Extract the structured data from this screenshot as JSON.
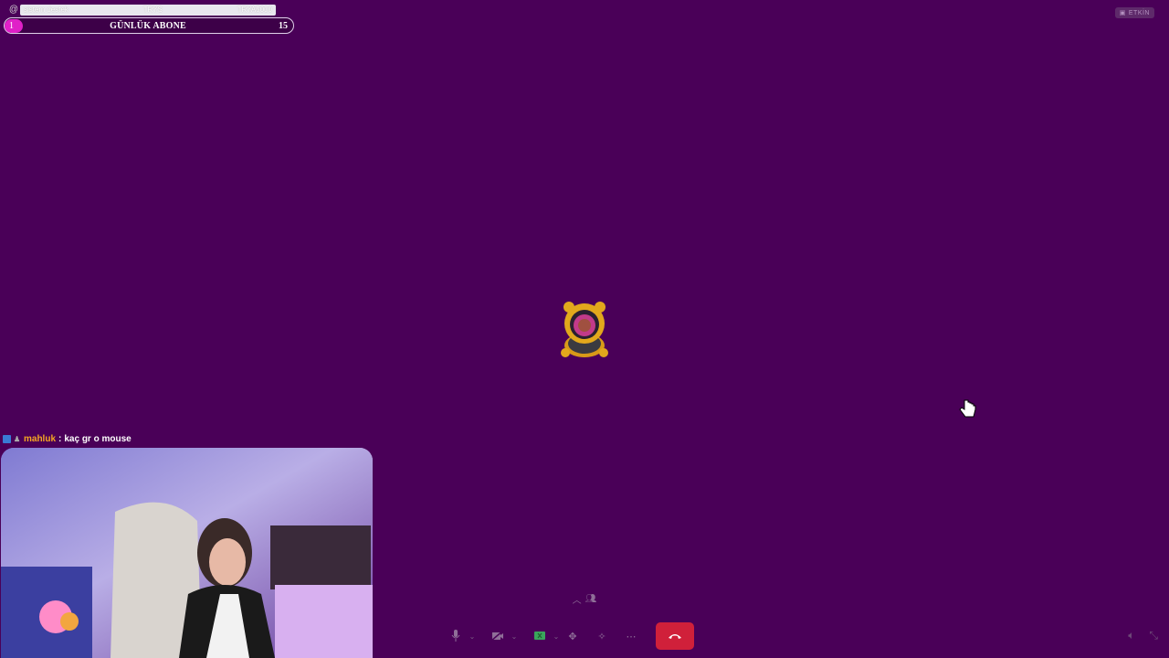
{
  "ticker": {
    "at_symbol": "@",
    "left_text": "sistem destek",
    "mid_text": "TRYS",
    "right_text": "TRYA5000"
  },
  "goal": {
    "current": "1",
    "title": "GÜNLÜK ABONE",
    "target": "15",
    "progress": 0.067,
    "fill_color": "#e020c8"
  },
  "top_right": {
    "label": "ETKİN",
    "icon": "screen-share-icon"
  },
  "call": {
    "background_color": "#4a0058",
    "participant_avatar_icon": "bear-avatar-icon"
  },
  "chat": {
    "username": "mahluk",
    "separator": " : ",
    "message": "kaç gr o mouse",
    "username_color": "#f5a623"
  },
  "controls": {
    "mic_icon": "microphone-icon",
    "camera_icon": "camera-off-icon",
    "screenshare_icon": "screen-share-icon",
    "activities_icon": "apps-icon",
    "soundboard_icon": "soundboard-icon",
    "more_icon": "more-icon",
    "hangup_icon": "phone-hangup-icon",
    "hangup_color": "#d0203a",
    "expand_icon": "chevron-up-icon",
    "participants_icon": "participants-icon",
    "volume_icon": "volume-icon",
    "fullscreen_icon": "fullscreen-exit-icon"
  }
}
